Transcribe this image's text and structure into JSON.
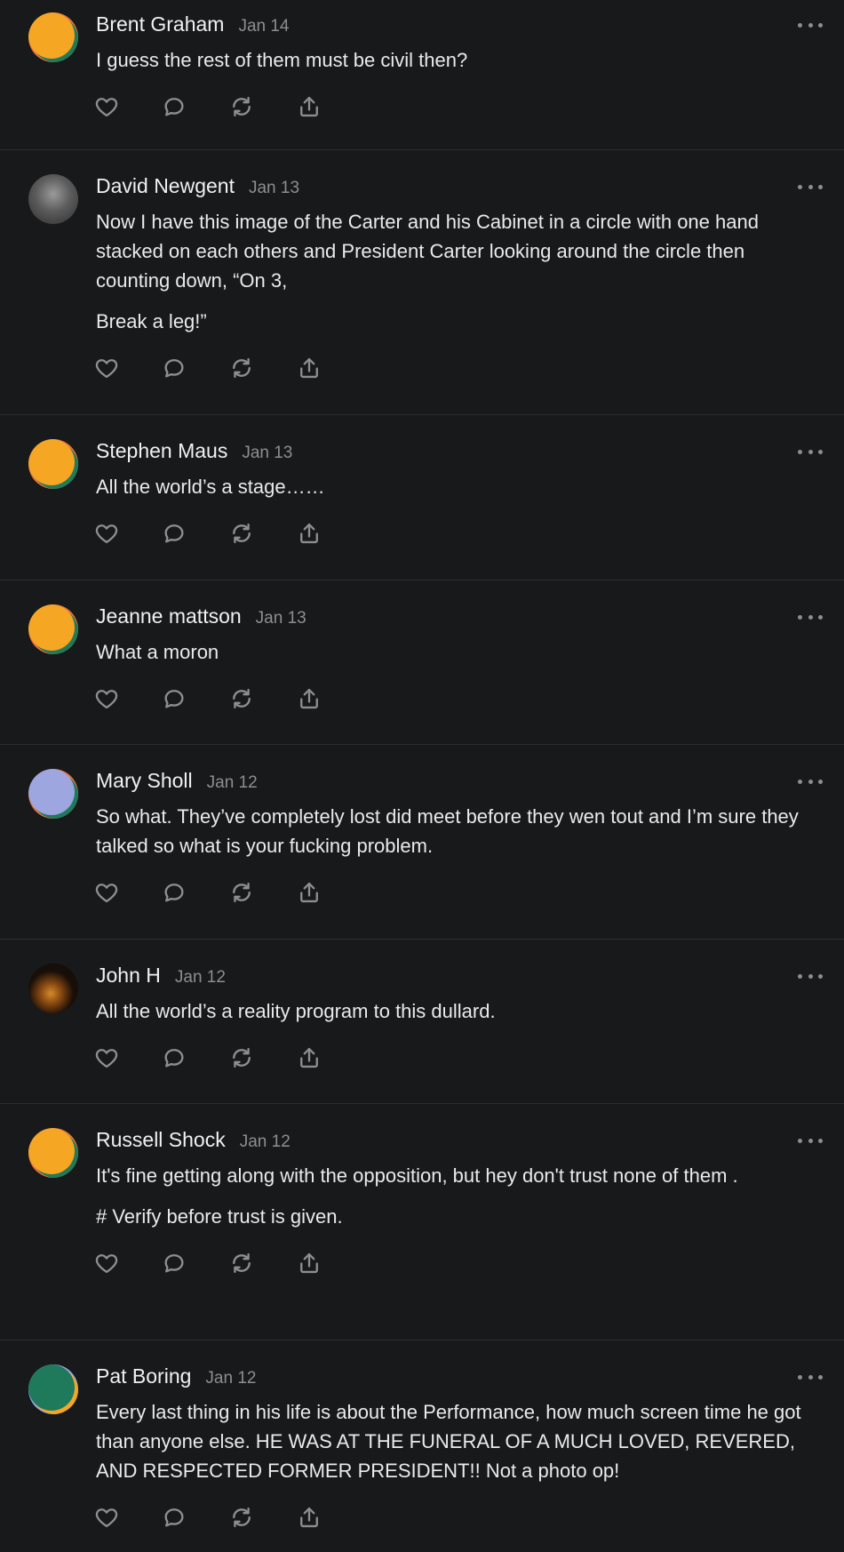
{
  "comments": [
    {
      "author": "Brent Graham",
      "date": "Jan 14",
      "paragraphs": [
        "I guess the rest of them must be civil then?"
      ],
      "avatar": {
        "type": "gradient",
        "front": "#f5a623",
        "back": "#1f7a5c",
        "edge": "#e8743b"
      }
    },
    {
      "author": "David Newgent",
      "date": "Jan 13",
      "paragraphs": [
        "Now I have this image of the Carter and his Cabinet in a circle with one hand stacked on each others and President Carter looking around the circle then counting down, “On 3,",
        "Break a leg!”"
      ],
      "avatar": {
        "type": "photo"
      }
    },
    {
      "author": "Stephen Maus",
      "date": "Jan 13",
      "paragraphs": [
        "All the world’s a stage……"
      ],
      "avatar": {
        "type": "gradient",
        "front": "#f5a623",
        "back": "#1f7a5c",
        "edge": "#e8743b"
      }
    },
    {
      "author": "Jeanne mattson",
      "date": "Jan 13",
      "paragraphs": [
        "What a moron"
      ],
      "avatar": {
        "type": "gradient",
        "front": "#f5a623",
        "back": "#1f7a5c",
        "edge": "#e8743b"
      }
    },
    {
      "author": "Mary Sholl",
      "date": "Jan 12",
      "paragraphs": [
        "So what. They’ve completely lost did meet before they wen tout and I’m sure they talked so what is your fucking problem."
      ],
      "avatar": {
        "type": "gradient",
        "front": "#9ea6e0",
        "back": "#1f7a5c",
        "edge": "#e8743b"
      }
    },
    {
      "author": "John H",
      "date": "Jan 12",
      "paragraphs": [
        "All the world’s a reality program to this dullard."
      ],
      "avatar": {
        "type": "glass"
      }
    },
    {
      "author": "Russell Shock",
      "date": "Jan 12",
      "paragraphs": [
        "It's fine getting along with the opposition, but hey don't trust none of them .",
        "# Verify before trust is given."
      ],
      "avatar": {
        "type": "gradient",
        "front": "#f5a623",
        "back": "#1f7a5c",
        "edge": "#e8743b"
      }
    },
    {
      "author": "Pat Boring",
      "date": "Jan 12",
      "paragraphs": [
        "Every last thing in his life is about the Performance, how much screen time he got than anyone else. HE WAS AT THE FUNERAL OF A MUCH LOVED, REVERED, AND RESPECTED FORMER PRESIDENT!! Not a photo op!"
      ],
      "avatar": {
        "type": "gradient",
        "front": "#1f7a5c",
        "back": "#f5a623",
        "edge": "#9ea6e0"
      }
    }
  ],
  "icons": {
    "like": "heart-icon",
    "reply": "comment-icon",
    "restack": "restack-icon",
    "share": "share-icon",
    "more": "more-options-icon"
  },
  "colors": {
    "background": "#18191b",
    "text": "#e9eaeb",
    "muted": "#8c8e92",
    "divider": "#2c2d30"
  }
}
